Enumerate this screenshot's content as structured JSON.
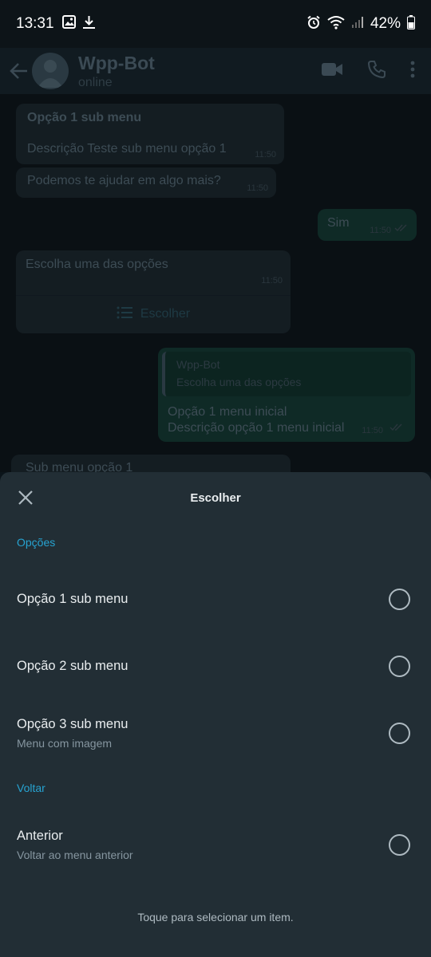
{
  "status_bar": {
    "time": "13:31",
    "battery": "42%",
    "icons_left": [
      "image-icon",
      "download-icon"
    ],
    "icons_right": [
      "alarm-icon",
      "wifi-icon",
      "signal-icon",
      "battery-icon"
    ]
  },
  "header": {
    "contact_name": "Wpp-Bot",
    "contact_status": "online"
  },
  "chat": {
    "m1_title": "Opção 1 sub menu",
    "m1_desc": "Descrição Teste sub menu opção 1",
    "m1_time": "11:50",
    "m2_text": "Podemos te ajudar em algo mais?",
    "m2_time": "11:50",
    "m3_text": "Sim",
    "m3_time": "11:50",
    "m4_text": "Escolha uma das opções",
    "m4_time": "11:50",
    "m4_button": "Escolher",
    "m5_quote_name": "Wpp-Bot",
    "m5_quote_text": "Escolha uma das opções",
    "m5_line1": "Opção 1 menu inicial",
    "m5_line2": "Descrição opção 1 menu inicial",
    "m5_time": "11:50",
    "m6_text": "Sub menu opção 1"
  },
  "sheet": {
    "title": "Escolher",
    "section1": "Opções",
    "section2": "Voltar",
    "options": [
      {
        "title": "Opção 1 sub menu",
        "subtitle": ""
      },
      {
        "title": "Opção 2 sub menu",
        "subtitle": ""
      },
      {
        "title": "Opção 3 sub menu",
        "subtitle": "Menu com imagem"
      },
      {
        "title": "Anterior",
        "subtitle": "Voltar ao menu anterior"
      }
    ],
    "hint": "Toque para selecionar um item."
  },
  "colors": {
    "accent": "#27a3d1",
    "sheet_bg": "#222e35",
    "text_primary": "#e9edef",
    "text_secondary": "#8696a0"
  }
}
